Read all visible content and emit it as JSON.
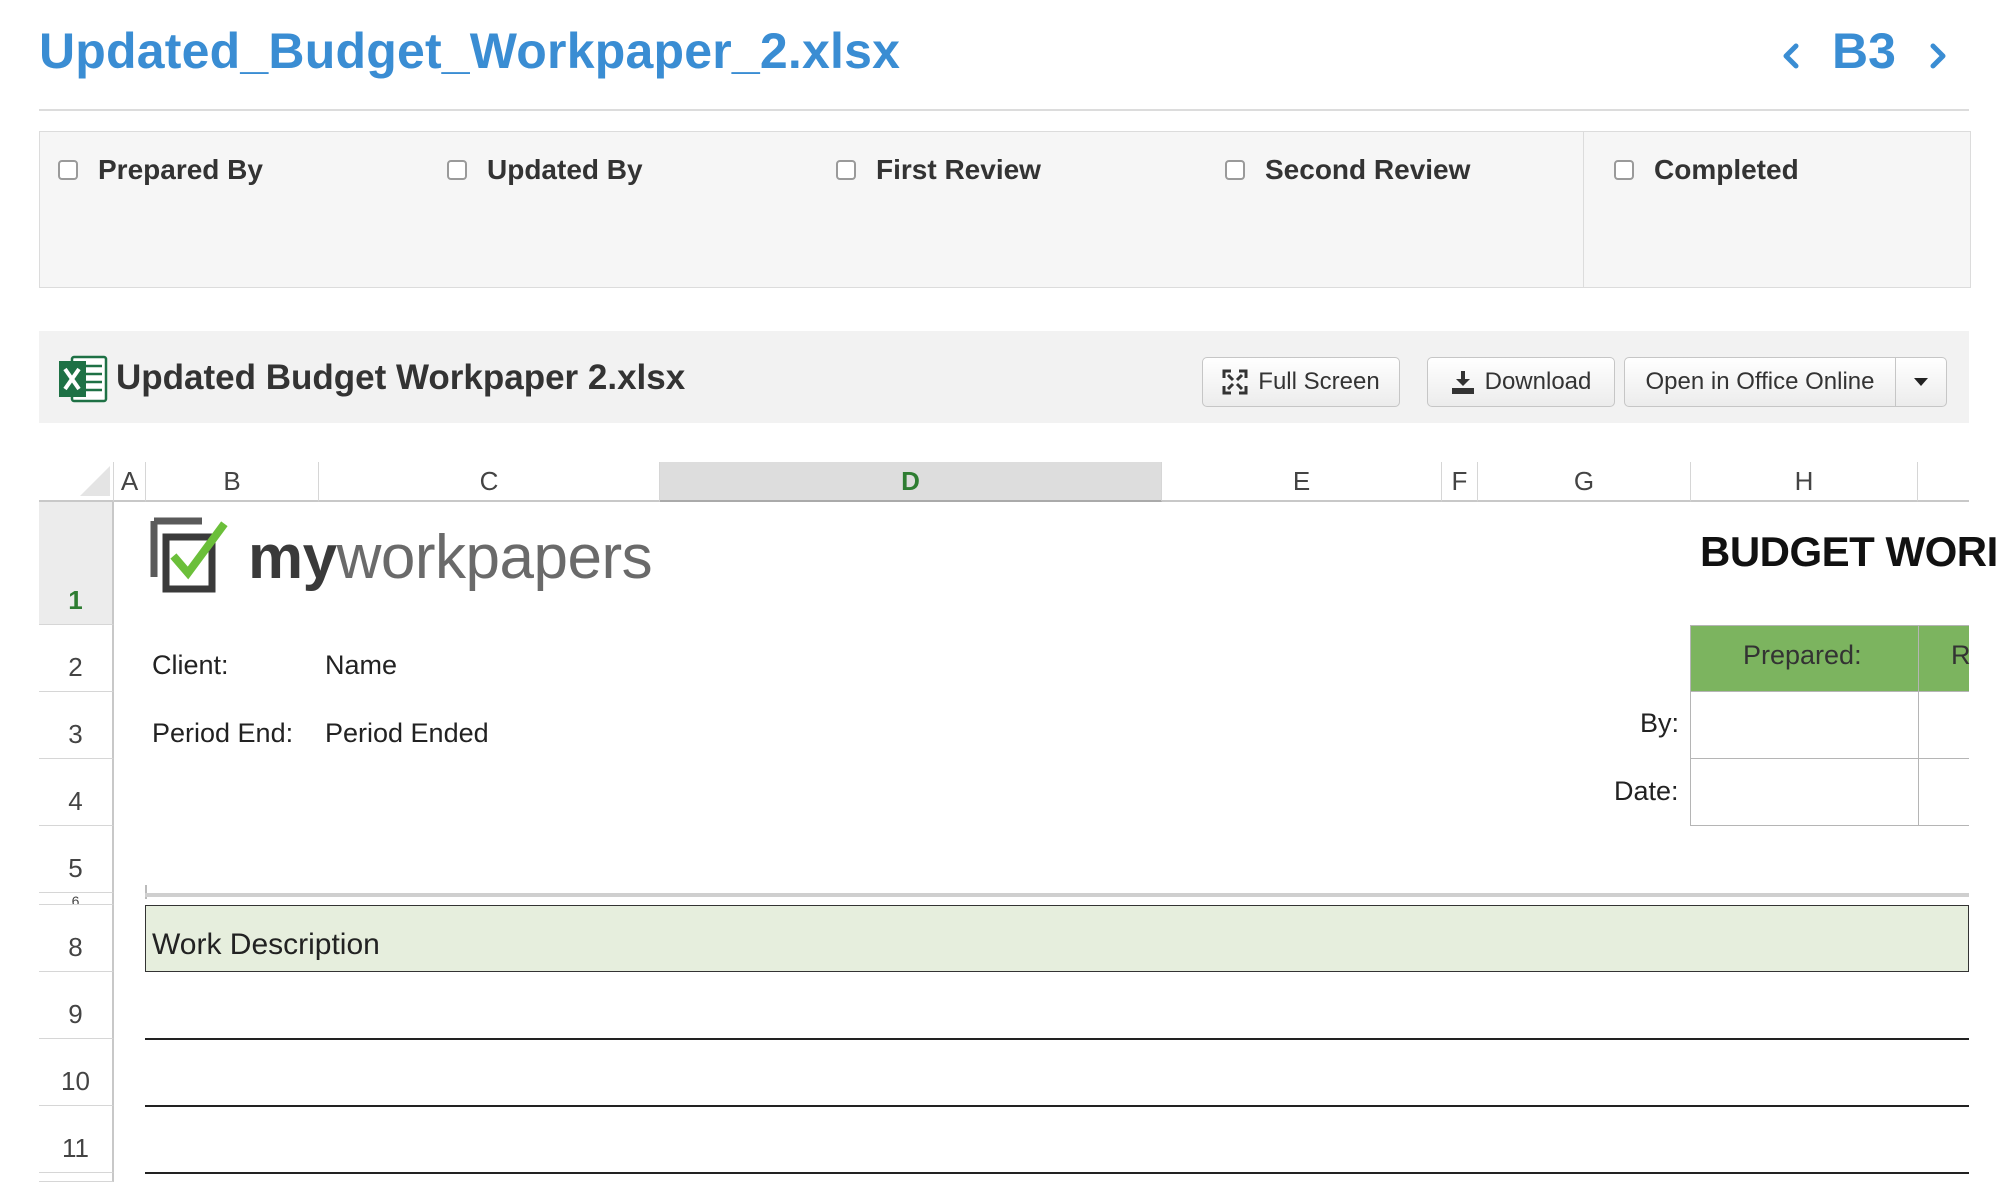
{
  "header": {
    "file_title": "Updated_Budget_Workpaper_2.xlsx",
    "cell_reference": "B3"
  },
  "signoffs": [
    {
      "label": "Prepared By",
      "checked": false
    },
    {
      "label": "Updated By",
      "checked": false
    },
    {
      "label": "First Review",
      "checked": false
    },
    {
      "label": "Second Review",
      "checked": false
    },
    {
      "label": "Completed",
      "checked": false
    }
  ],
  "viewer": {
    "title": "Updated Budget Workpaper 2.xlsx",
    "icon": "excel-icon",
    "buttons": {
      "full_screen": "Full Screen",
      "download": "Download",
      "open_office": "Open in Office Online"
    }
  },
  "sheet": {
    "columns": [
      "A",
      "B",
      "C",
      "D",
      "E",
      "F",
      "G",
      "H"
    ],
    "active_column": "D",
    "rows": [
      "1",
      "2",
      "3",
      "4",
      "5",
      "6",
      "8",
      "9",
      "10",
      "11"
    ],
    "active_row": "1",
    "logo": {
      "bold": "my",
      "rest": "workpapers"
    },
    "title": "BUDGET WORI",
    "client_label": "Client:",
    "client_value": "Name",
    "period_label": "Period End:",
    "period_value": "Period Ended",
    "signoff_table": {
      "prepared_header": "Prepared:",
      "next_header_partial": "R",
      "by_label": "By:",
      "date_label": "Date:"
    },
    "work_description": "Work Description"
  },
  "colors": {
    "accent": "#3a8dd3",
    "green_header": "#7cb45f",
    "work_band": "#e6eedd"
  }
}
